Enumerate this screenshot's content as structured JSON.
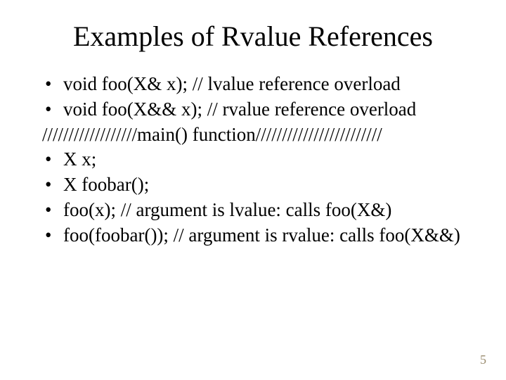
{
  "title": "Examples of Rvalue References",
  "lines": {
    "b1": "void foo(X& x); // lvalue reference overload",
    "b2": "void foo(X&& x); // rvalue reference overload",
    "sep": "//////////////////main() function////////////////////////",
    "b3": "X x;",
    "b4": "X foobar();",
    "b5": "foo(x);   // argument is lvalue: calls foo(X&)",
    "b6": "foo(foobar()); // argument is rvalue: calls foo(X&&)"
  },
  "page_number": "5"
}
